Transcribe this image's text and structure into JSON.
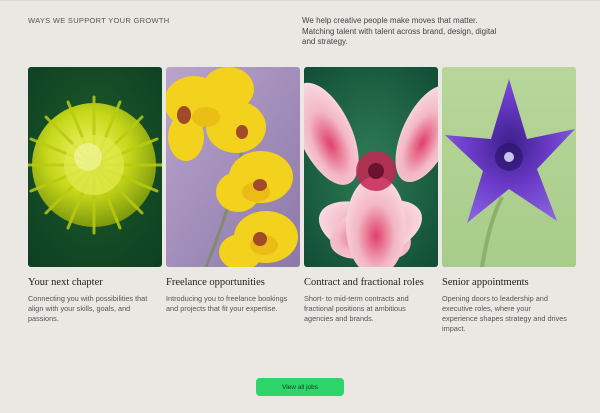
{
  "header": {
    "section_label": "WAYS WE SUPPORT YOUR GROWTH",
    "intro": "We help creative people make moves that matter. Matching talent with talent across brand, design, digital and strategy."
  },
  "cards": [
    {
      "title": "Your next chapter",
      "description": "Connecting you with possibilities that align with your skills, goals, and passions.",
      "image_subject": "chartreuse-chrysanthemum"
    },
    {
      "title": "Freelance opportunities",
      "description": "Introducing you to freelance bookings and projects that fit your expertise.",
      "image_subject": "yellow-orchid"
    },
    {
      "title": "Contract and fractional roles",
      "description": "Short- to mid-term contracts and fractional positions at ambitious agencies and brands.",
      "image_subject": "pink-lily"
    },
    {
      "title": "Senior appointments",
      "description": "Opening doors to leadership and executive roles, where your experience shapes strategy and drives impact.",
      "image_subject": "purple-bellflower"
    }
  ],
  "cta": {
    "label": "View all jobs",
    "color": "#2ed46a"
  },
  "colors": {
    "background": "#ebe7e3",
    "text": "#2a2a2a"
  }
}
